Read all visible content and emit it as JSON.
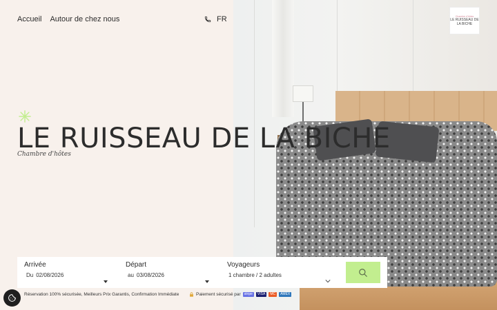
{
  "nav": {
    "items": [
      {
        "label": "Accueil"
      },
      {
        "label": "Autour de chez nous"
      }
    ],
    "language": "FR"
  },
  "logo": {
    "top": "Chambre d'hôtes",
    "main": "LE RUISSEAU DE LA BICHE"
  },
  "hero": {
    "title": "LE RUISSEAU DE LA BICHE",
    "subtitle": "Chambre d'hôtes"
  },
  "booking": {
    "arrival": {
      "label": "Arrivée",
      "prefix": "Du",
      "value": "02/08/2026"
    },
    "departure": {
      "label": "Départ",
      "prefix": "au",
      "value": "03/08/2026"
    },
    "guests": {
      "label": "Voyageurs",
      "value": "1 chambre / 2 adultes"
    }
  },
  "footer": {
    "reassurance": "Réservation 100% sécurisée, Meilleurs Prix Garantis, Confirmation Immédiate",
    "secure_payment": "Paiement sécurisé par",
    "payment_methods": [
      "stripe",
      "VISA",
      "MC",
      "AMEX"
    ]
  },
  "colors": {
    "background": "#f8f1ec",
    "accent": "#c2ee8f"
  }
}
